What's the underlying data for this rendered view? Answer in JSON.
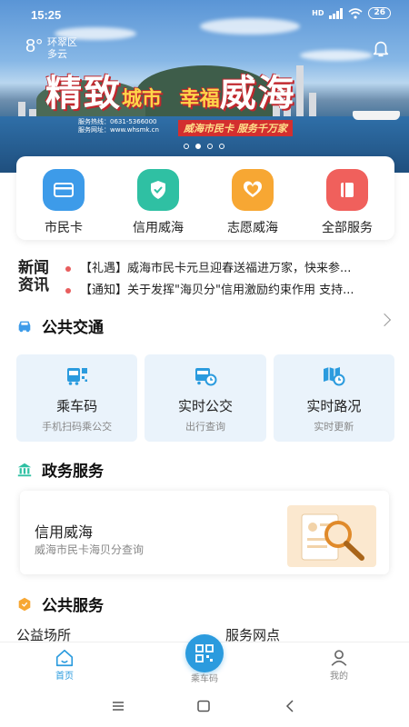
{
  "status": {
    "time": "15:25",
    "network": "HD",
    "battery": "26"
  },
  "weather": {
    "temp": "8°",
    "district": "环翠区",
    "condition": "多云"
  },
  "banner": {
    "slogan_left_big": "精致",
    "slogan_left_small": "城市",
    "slogan_right_small": "幸福",
    "slogan_right_big": "威海",
    "hotline": "服务热线：0631-5366000",
    "website": "服务网址：www.whsmk.cn",
    "tagline": "威海市民卡  服务千万家",
    "slide_count": 4,
    "active_slide": 2
  },
  "quick_services": [
    {
      "label": "市民卡",
      "icon": "card-icon",
      "color": "#3d9be9"
    },
    {
      "label": "信用威海",
      "icon": "shield-check-icon",
      "color": "#2fc0a3"
    },
    {
      "label": "志愿威海",
      "icon": "heart-hands-icon",
      "color": "#f7a733"
    },
    {
      "label": "全部服务",
      "icon": "book-icon",
      "color": "#f0605c"
    }
  ],
  "news": {
    "badge_line1": "新闻",
    "badge_line2": "资讯",
    "items": [
      "【礼遇】威海市民卡元旦迎春送福进万家，快来参...",
      "【通知】关于发挥\"海贝分\"信用激励约束作用 支持..."
    ]
  },
  "transport": {
    "title": "公共交通",
    "cards": [
      {
        "title": "乘车码",
        "subtitle": "手机扫码乘公交",
        "icon": "bus-qr-icon"
      },
      {
        "title": "实时公交",
        "subtitle": "出行查询",
        "icon": "bus-clock-icon"
      },
      {
        "title": "实时路况",
        "subtitle": "实时更新",
        "icon": "map-clock-icon"
      }
    ]
  },
  "gov": {
    "title": "政务服务",
    "card_title": "信用威海",
    "card_subtitle": "威海市民卡海贝分查询"
  },
  "public": {
    "title": "公共服务",
    "items": [
      "公益场所",
      "服务网点"
    ]
  },
  "tabbar": {
    "home": "首页",
    "center": "乘车码",
    "mine": "我的"
  },
  "colors": {
    "accent": "#2b9bde",
    "news_dot": "#e85d5d"
  }
}
